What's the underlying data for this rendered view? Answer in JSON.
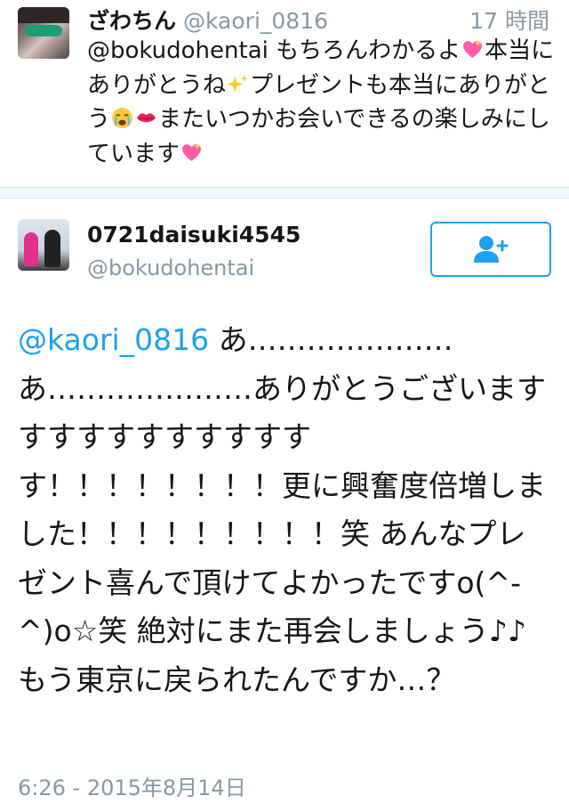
{
  "reply": {
    "display_name": "ざわちん",
    "handle": "@kaori_0816",
    "time": "17 時間",
    "text_1": "@bokudohentai もちろんわかるよ",
    "text_2": "本当にありがとうね",
    "text_3": "プレゼントも本当にありがとう",
    "text_4": "またいつかお会いできるの楽しみにしています"
  },
  "tweet": {
    "display_name": "0721daisuki4545",
    "handle": "@bokudohentai",
    "mention": "@kaori_0816",
    "body": " あ…………………あ…………………ありがとうございますすすすすすすすすすすす！！！！！！！！更に興奮度倍増しました！！！！！！！！！笑 あんなプレゼント喜んで頂けてよかったですo(^-^)o☆笑 絶対にまた再会しましょう♪♪もう東京に戻られたんですか…？",
    "timestamp": "6:26 - 2015年8月14日"
  },
  "icons": {
    "follow": "add-user-icon",
    "emoji_1": "sparkling-heart-emoji",
    "emoji_2": "sparkles-emoji",
    "emoji_3": "crying-face-emoji",
    "emoji_4": "kiss-mark-emoji"
  },
  "colors": {
    "link": "#1da1f2",
    "muted": "#8899a6",
    "text": "#14171a"
  }
}
